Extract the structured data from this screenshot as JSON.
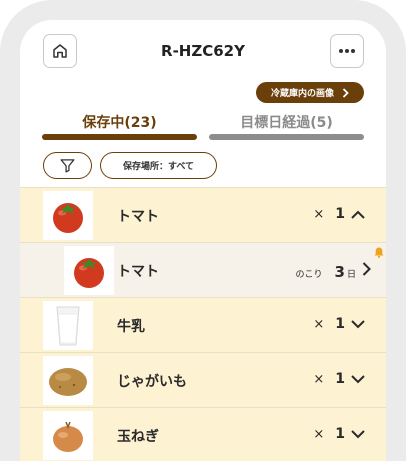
{
  "header": {
    "title": "R-HZC62Y",
    "home_icon": "home-icon",
    "more_icon": "more-dots-icon"
  },
  "fridge_button": {
    "label": "冷蔵庫内の画像",
    "icon": "chevron-right-icon"
  },
  "tabs": [
    {
      "label": "保存中(23)",
      "active": true
    },
    {
      "label": "目標日経過(5)",
      "active": false
    }
  ],
  "filters": {
    "filter_icon": "filter-icon",
    "location_label": "保存場所：すべて"
  },
  "items": [
    {
      "name": "トマト",
      "qty_prefix": "×",
      "qty": "1",
      "expanded": true,
      "thumb": "tomato"
    },
    {
      "name": "トマト",
      "remain_label": "のこり",
      "remain_days": "3",
      "remain_unit": "日",
      "thumb": "tomato",
      "alert": true
    },
    {
      "name": "牛乳",
      "qty_prefix": "×",
      "qty": "1",
      "expanded": false,
      "thumb": "milk"
    },
    {
      "name": "じゃがいも",
      "qty_prefix": "×",
      "qty": "1",
      "expanded": false,
      "thumb": "potato"
    },
    {
      "name": "玉ねぎ",
      "qty_prefix": "×",
      "qty": "1",
      "expanded": false,
      "thumb": "onion"
    }
  ],
  "colors": {
    "brand": "#6b3f0a",
    "row_bg": "#fdf2d2",
    "sub_row_bg": "#f6f2ea",
    "alert": "#f0a21a"
  }
}
